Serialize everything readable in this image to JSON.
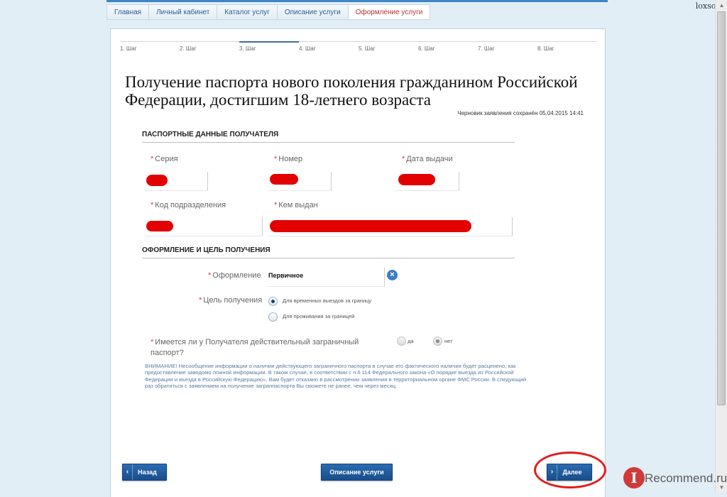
{
  "breadcrumbs": [
    {
      "label": "Главная"
    },
    {
      "label": "Личный кабинет"
    },
    {
      "label": "Каталог услуг"
    },
    {
      "label": "Описание услуги"
    },
    {
      "label": "Оформление услуги",
      "active": true
    }
  ],
  "brand": "loxsos",
  "steps": [
    "1. Шаг",
    "2. Шаг",
    "3. Шаг",
    "4. Шаг",
    "5. Шаг",
    "6. Шаг",
    "7. Шаг",
    "8. Шаг"
  ],
  "current_step": 3,
  "page_title": "Получение паспорта нового поколения гражданином Российской Федерации, достигшим 18-летнего возраста",
  "draft_notice": "Черновик заявления сохранён 05.04.2015 14:41",
  "passport_section": {
    "heading": "ПАСПОРТНЫЕ ДАННЫЕ ПОЛУЧАТЕЛЯ",
    "series_label": "Серия",
    "number_label": "Номер",
    "issue_date_label": "Дата выдачи",
    "division_code_label": "Код подразделения",
    "issued_by_label": "Кем выдан"
  },
  "purpose_section": {
    "heading": "ОФОРМЛЕНИЕ И ЦЕЛЬ ПОЛУЧЕНИЯ",
    "registration_label": "Оформление",
    "registration_value": "Первичное",
    "purpose_label": "Цель получения",
    "purpose_options": [
      "Для временных выездов за границу",
      "Для проживания за границей"
    ],
    "purpose_selected": 0,
    "has_passport_label": "Имеется ли у Получателя действительный заграничный паспорт?",
    "has_passport_options": [
      "да",
      "нет"
    ],
    "has_passport_selected": 1
  },
  "warning": "ВНИМАНИЕ! Несообщение информации о наличии действующего заграничного паспорта в случае его фактического наличия будет расценено, как предоставление заведомо ложной информации. В таком случае, в соответствии с п.6 114 Федерального закона «О порядке выезда из Российской Федерации и въезда в Российскую Федерацию», Вам будет отказано в рассмотрении заявления в территориальном органе ФМС России. В следующий раз обратиться с заявлением на получение загранпаспорта Вы сможете не ранее, чем через месяц.",
  "buttons": {
    "back": "Назад",
    "service_description": "Описание услуги",
    "next": "Далее"
  },
  "watermark": {
    "badge": "I",
    "text": "Recommend.ru"
  },
  "colors": {
    "accent": "#2b6bb0",
    "required": "#d23b3b",
    "active_tab": "#c03030",
    "redaction": "#e30000",
    "highlight_circle": "#e21d1d"
  }
}
